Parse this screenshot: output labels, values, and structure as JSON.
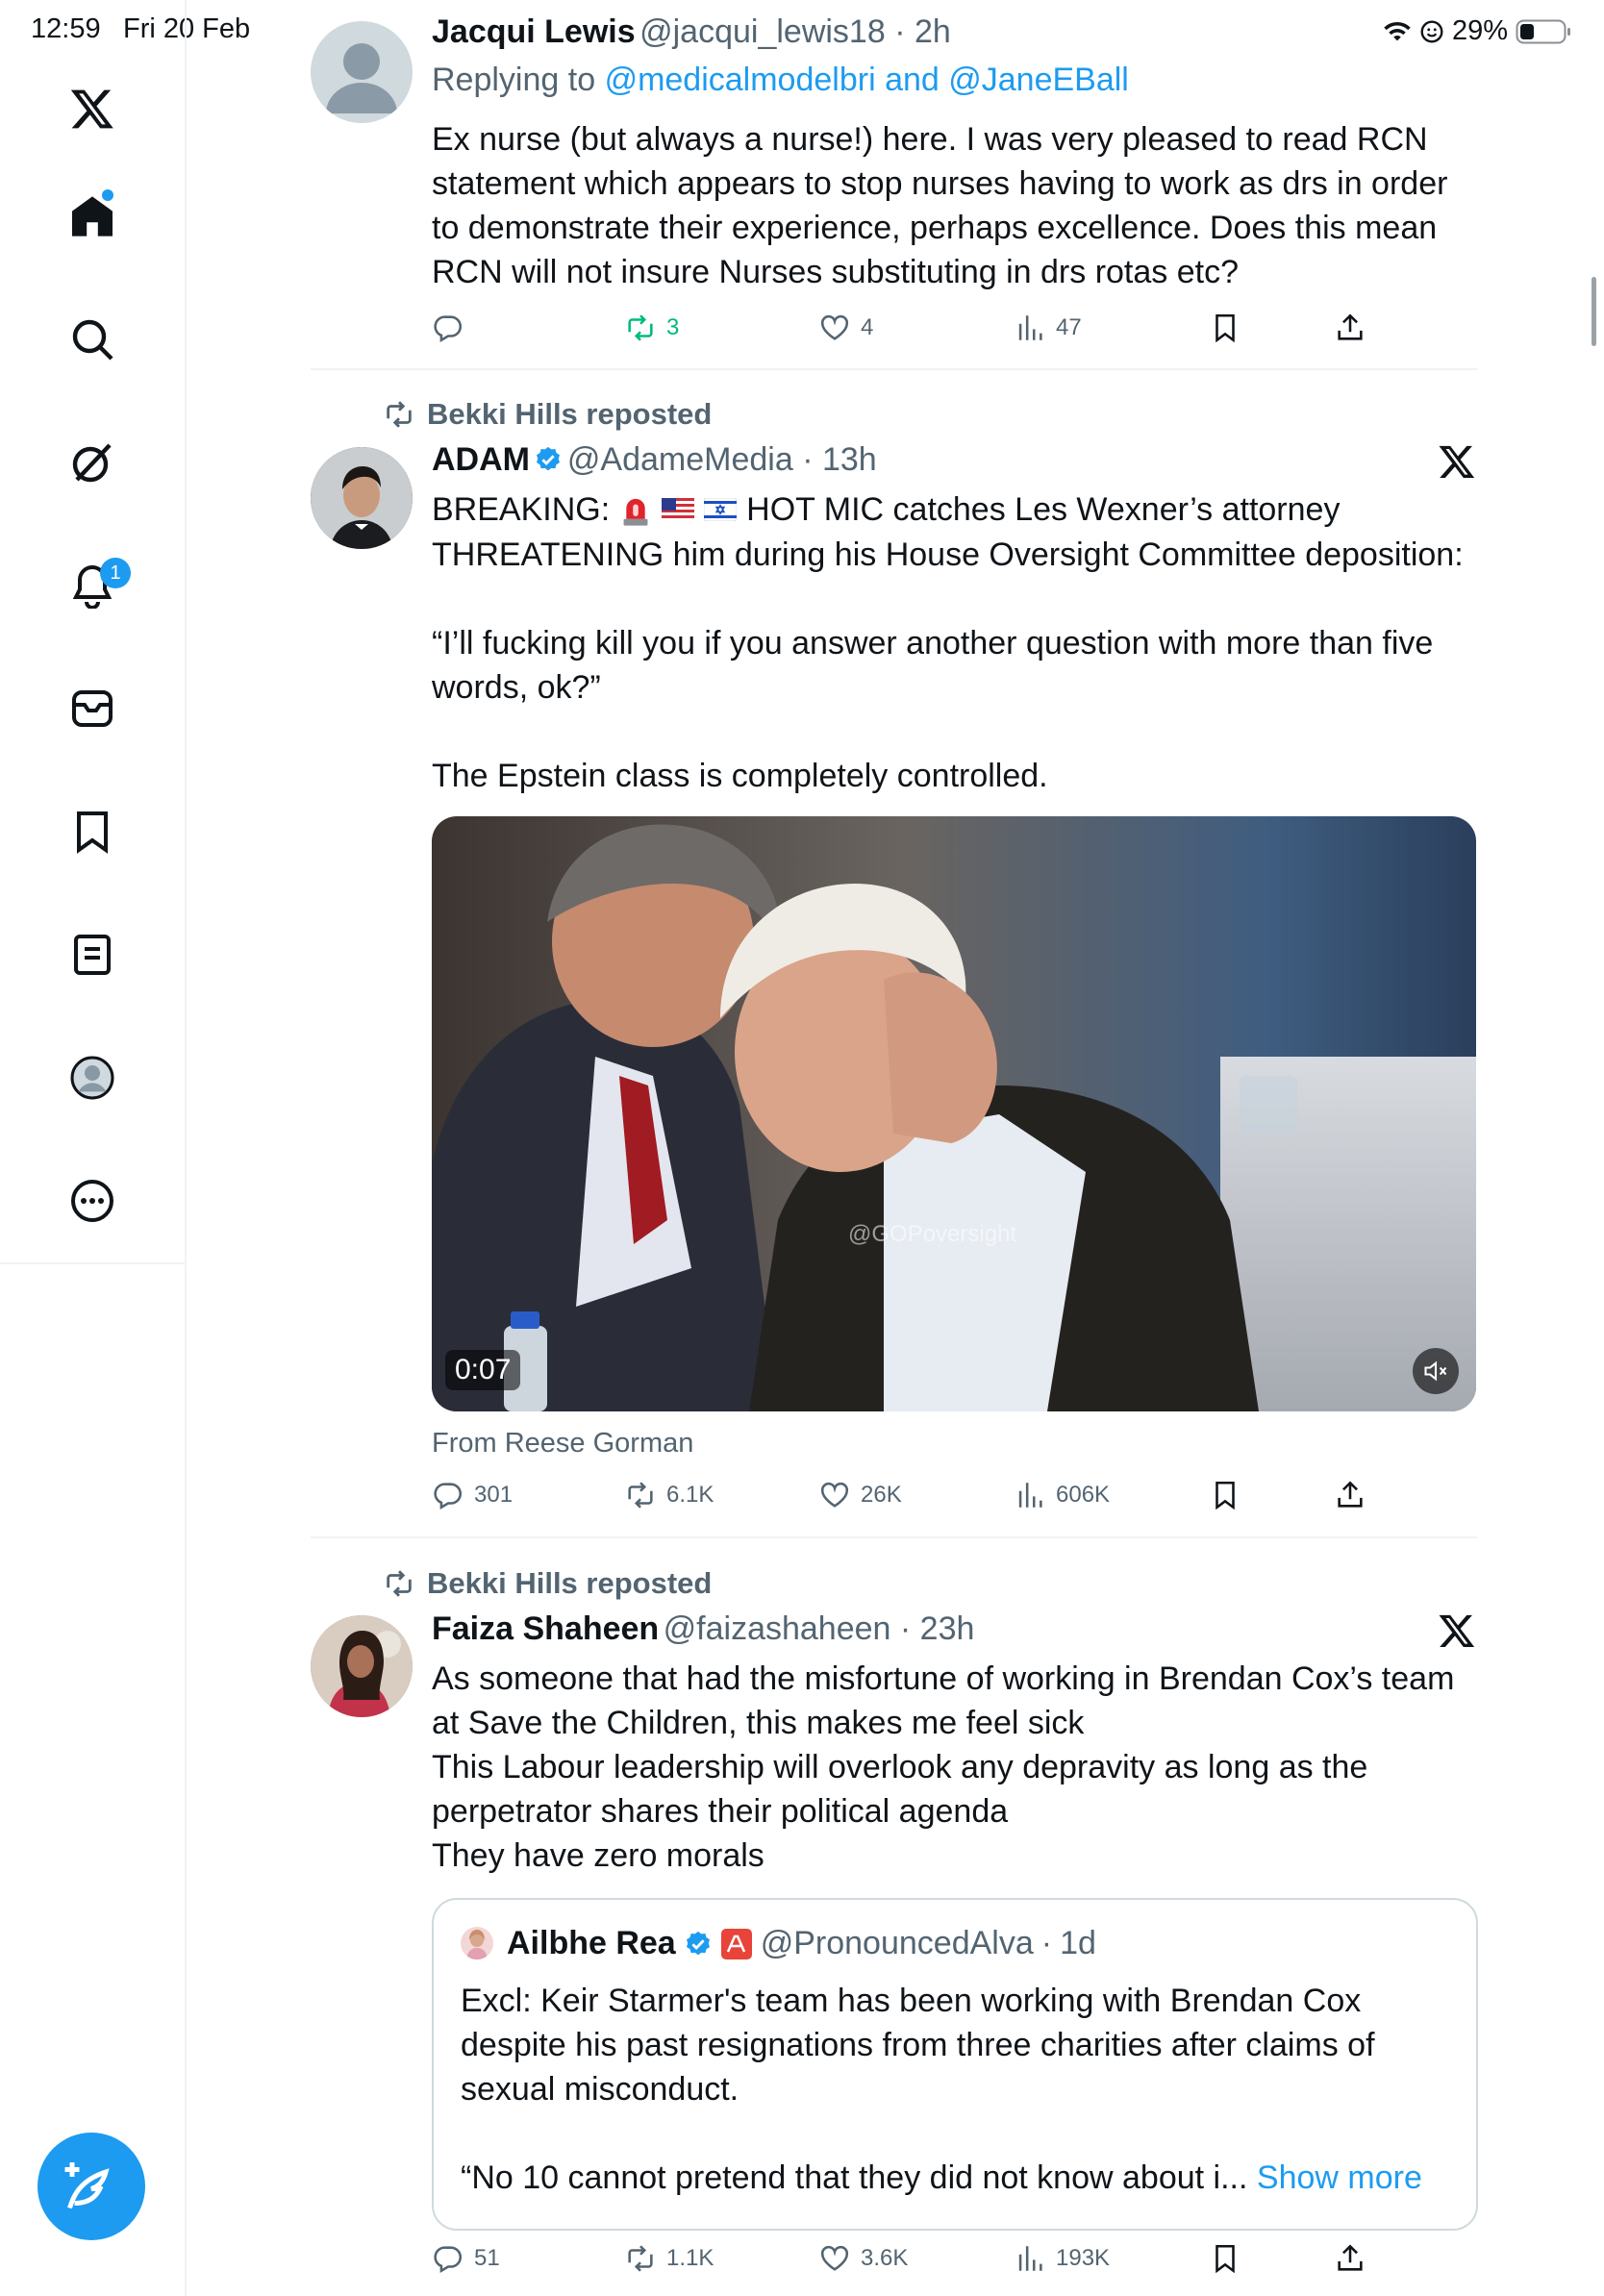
{
  "status_bar": {
    "time": "12:59",
    "date": "Fri 20 Feb",
    "battery": "29%"
  },
  "sidebar": {
    "notifications_badge": "1",
    "items": [
      "x-logo-icon",
      "home-icon",
      "search-icon",
      "grok-icon",
      "notifications-icon",
      "messages-icon",
      "bookmarks-icon",
      "lists-icon",
      "profile-icon",
      "more-icon"
    ]
  },
  "tweets": [
    {
      "name": "Jacqui Lewis",
      "handle": "@jacqui_lewis18",
      "time": "2h",
      "replying_prefix": "Replying to",
      "replying_users": "@medicalmodelbri and @JaneEBall",
      "text": "Ex nurse (but always a nurse!) here. I was very pleased to read RCN statement which appears to stop nurses having to work as drs in order to demonstrate their experience, perhaps excellence. Does this mean RCN will not insure Nurses substituting in drs rotas etc?",
      "replies": "",
      "reposts": "3",
      "likes": "4",
      "views": "47"
    },
    {
      "reposted_by": "Bekki Hills reposted",
      "name": "ADAM",
      "handle": "@AdameMedia",
      "time": "13h",
      "text_line1_pre": "BREAKING:",
      "text_line1_post": "HOT MIC catches Les Wexner’s attorney",
      "text_rest": "THREATENING him during his House Oversight Committee deposition:\n\n“I’ll fucking kill you if you answer another question with more than five words, ok?”\n\nThe Epstein class is completely controlled.",
      "video_time": "0:07",
      "watermark": "@GOPoversight",
      "from": "From Reese Gorman",
      "replies": "301",
      "reposts": "6.1K",
      "likes": "26K",
      "views": "606K"
    },
    {
      "reposted_by": "Bekki Hills reposted",
      "name": "Faiza Shaheen",
      "handle": "@faizashaheen",
      "time": "23h",
      "text": "As someone that had the misfortune of working in Brendan Cox’s team at Save the Children, this makes me feel sick\nThis Labour leadership will overlook any depravity as long as the perpetrator shares their political agenda\nThey have zero morals",
      "quote": {
        "name": "Ailbhe Rea",
        "handle": "@PronouncedAlva",
        "time": "1d",
        "text": "Excl: Keir Starmer's team has been working with Brendan Cox despite his past resignations from three charities after claims of sexual misconduct.",
        "text2": "“No 10 cannot pretend that they did not know about i...",
        "show_more": "Show more"
      },
      "replies": "51",
      "reposts": "1.1K",
      "likes": "3.6K",
      "views": "193K"
    }
  ]
}
